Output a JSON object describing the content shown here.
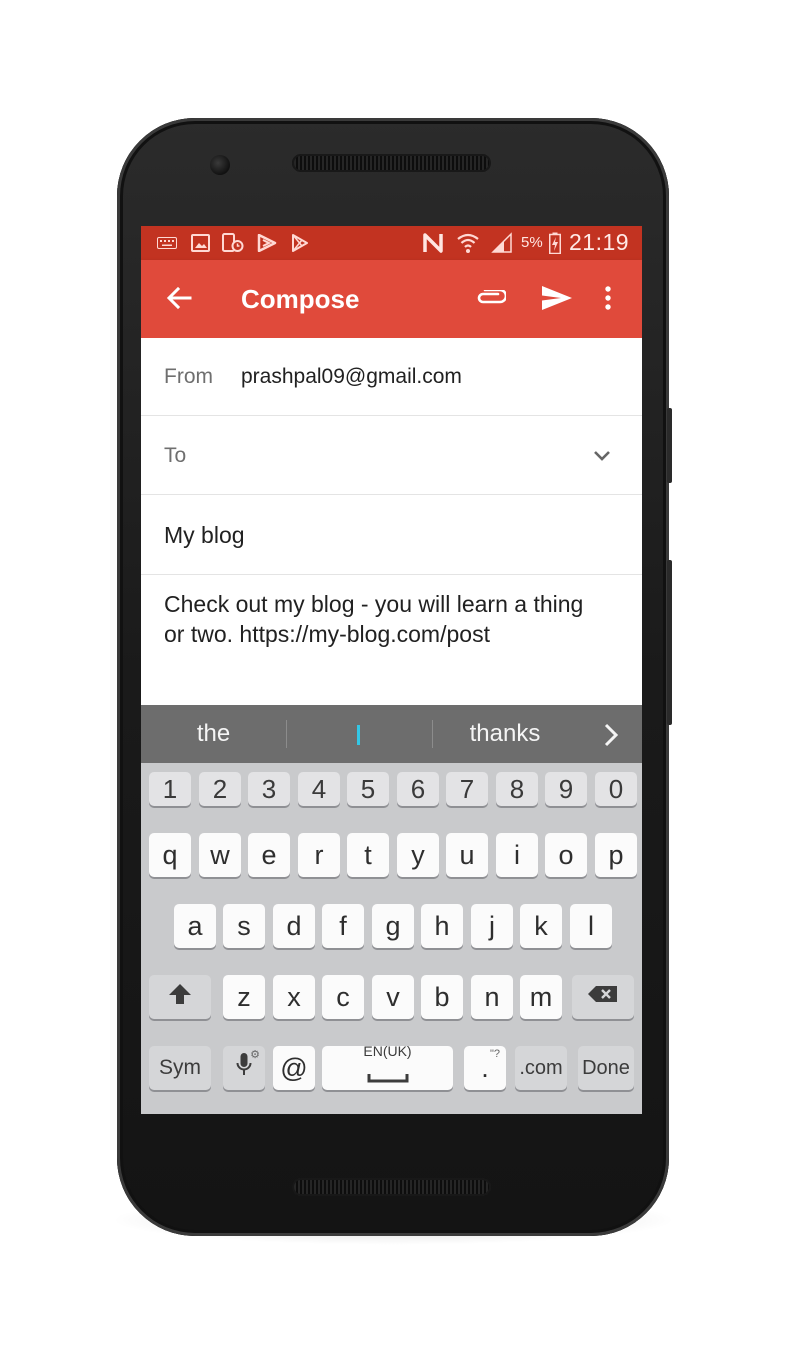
{
  "status_bar": {
    "icons": [
      "keyboard-icon",
      "gallery-icon",
      "phone-clock-icon",
      "play-alt-icon",
      "play-store-icon",
      "nfc-icon",
      "wifi-icon",
      "signal-icon",
      "battery-charging-icon"
    ],
    "battery": "5%",
    "time": "21:19"
  },
  "app_bar": {
    "title": "Compose",
    "back_icon": "arrow-back-icon",
    "attach_icon": "paperclip-icon",
    "send_icon": "send-icon",
    "menu_icon": "more-vert-icon"
  },
  "compose": {
    "from_label": "From",
    "from_value": "prashpal09@gmail.com",
    "to_label": "To",
    "subject": "My blog",
    "body_line1": "Check out my blog - you will learn a thing",
    "body_line2": "or two. https://my-blog.com/post"
  },
  "suggestions": {
    "left": "the",
    "right": "thanks"
  },
  "keyboard": {
    "row_numbers": [
      "1",
      "2",
      "3",
      "4",
      "5",
      "6",
      "7",
      "8",
      "9",
      "0"
    ],
    "row1": [
      "q",
      "w",
      "e",
      "r",
      "t",
      "y",
      "u",
      "i",
      "o",
      "p"
    ],
    "row2": [
      "a",
      "s",
      "d",
      "f",
      "g",
      "h",
      "j",
      "k",
      "l"
    ],
    "row3": [
      "z",
      "x",
      "c",
      "v",
      "b",
      "n",
      "m"
    ],
    "sym": "Sym",
    "at": "@",
    "space": "EN(UK)",
    "period": ".",
    "period_hint": "\"?",
    "dotcom": ".com",
    "done": "Done"
  },
  "colors": {
    "status_bar": "#c23321",
    "app_bar": "#e04a3b",
    "suggestion_bar": "#6d6d6d",
    "keyboard_bg": "#c9cacc",
    "cursor": "#33c7e6"
  }
}
